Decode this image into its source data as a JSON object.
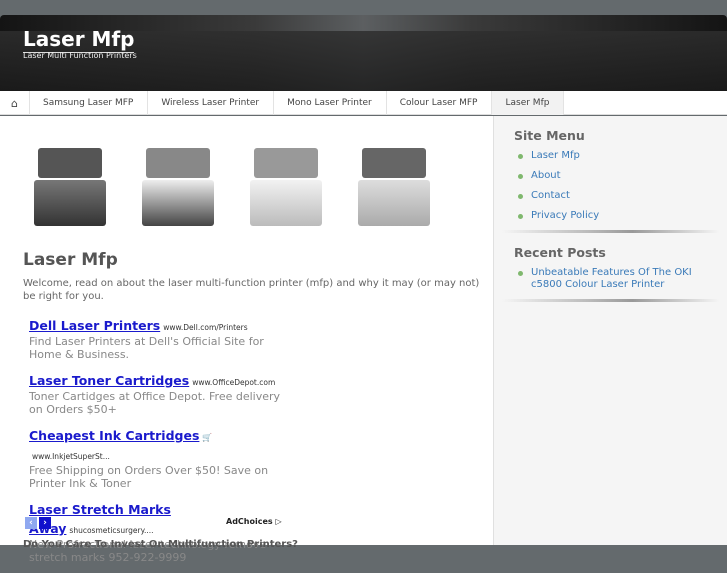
{
  "header": {
    "title": "Laser Mfp",
    "tagline": "Laser Multi Function Printers"
  },
  "nav": {
    "items": [
      {
        "label": "Samsung Laser MFP"
      },
      {
        "label": "Wireless Laser Printer"
      },
      {
        "label": "Mono Laser Printer"
      },
      {
        "label": "Colour Laser MFP"
      },
      {
        "label": "Laser Mfp"
      }
    ],
    "home_icon": "home-icon"
  },
  "main": {
    "title": "Laser Mfp",
    "intro": "Welcome, read on about the laser multi-function printer (mfp) and why it may (or may not) be right for you.",
    "ads": [
      {
        "title": "Dell Laser Printers",
        "url": "www.Dell.com/Printers",
        "desc": "Find Laser Printers at Dell's Official Site for Home & Business."
      },
      {
        "title": "Laser Toner Cartridges",
        "url": "www.OfficeDepot.com",
        "desc": "Toner Cartidges at Office Depot. Free delivery on Orders $50+"
      },
      {
        "title": "Cheapest Ink Cartridges",
        "url": "www.InkjetSuperSt...",
        "desc": "Free Shipping on Orders Over $50! Save on Printer Ink & Toner"
      },
      {
        "title": "Laser Stretch Marks Away",
        "url": "shucosmeticsurgery....",
        "desc": "New Profractional laser technology remove stretch marks 952-922-9999"
      }
    ],
    "adchoices": "AdChoices",
    "next_heading": "Do You Care To Invest On Multifunction Printers?"
  },
  "sidebar": {
    "site_menu": {
      "title": "Site Menu",
      "items": [
        "Laser Mfp",
        "About",
        "Contact",
        "Privacy Policy"
      ]
    },
    "recent_posts": {
      "title": "Recent Posts",
      "items": [
        "Unbeatable Features Of The OKI c5800 Colour Laser Printer"
      ]
    }
  },
  "colors": {
    "link": "#1a1acc",
    "sidebar_link": "#3a7ab8",
    "bullet": "#7fb86e"
  }
}
